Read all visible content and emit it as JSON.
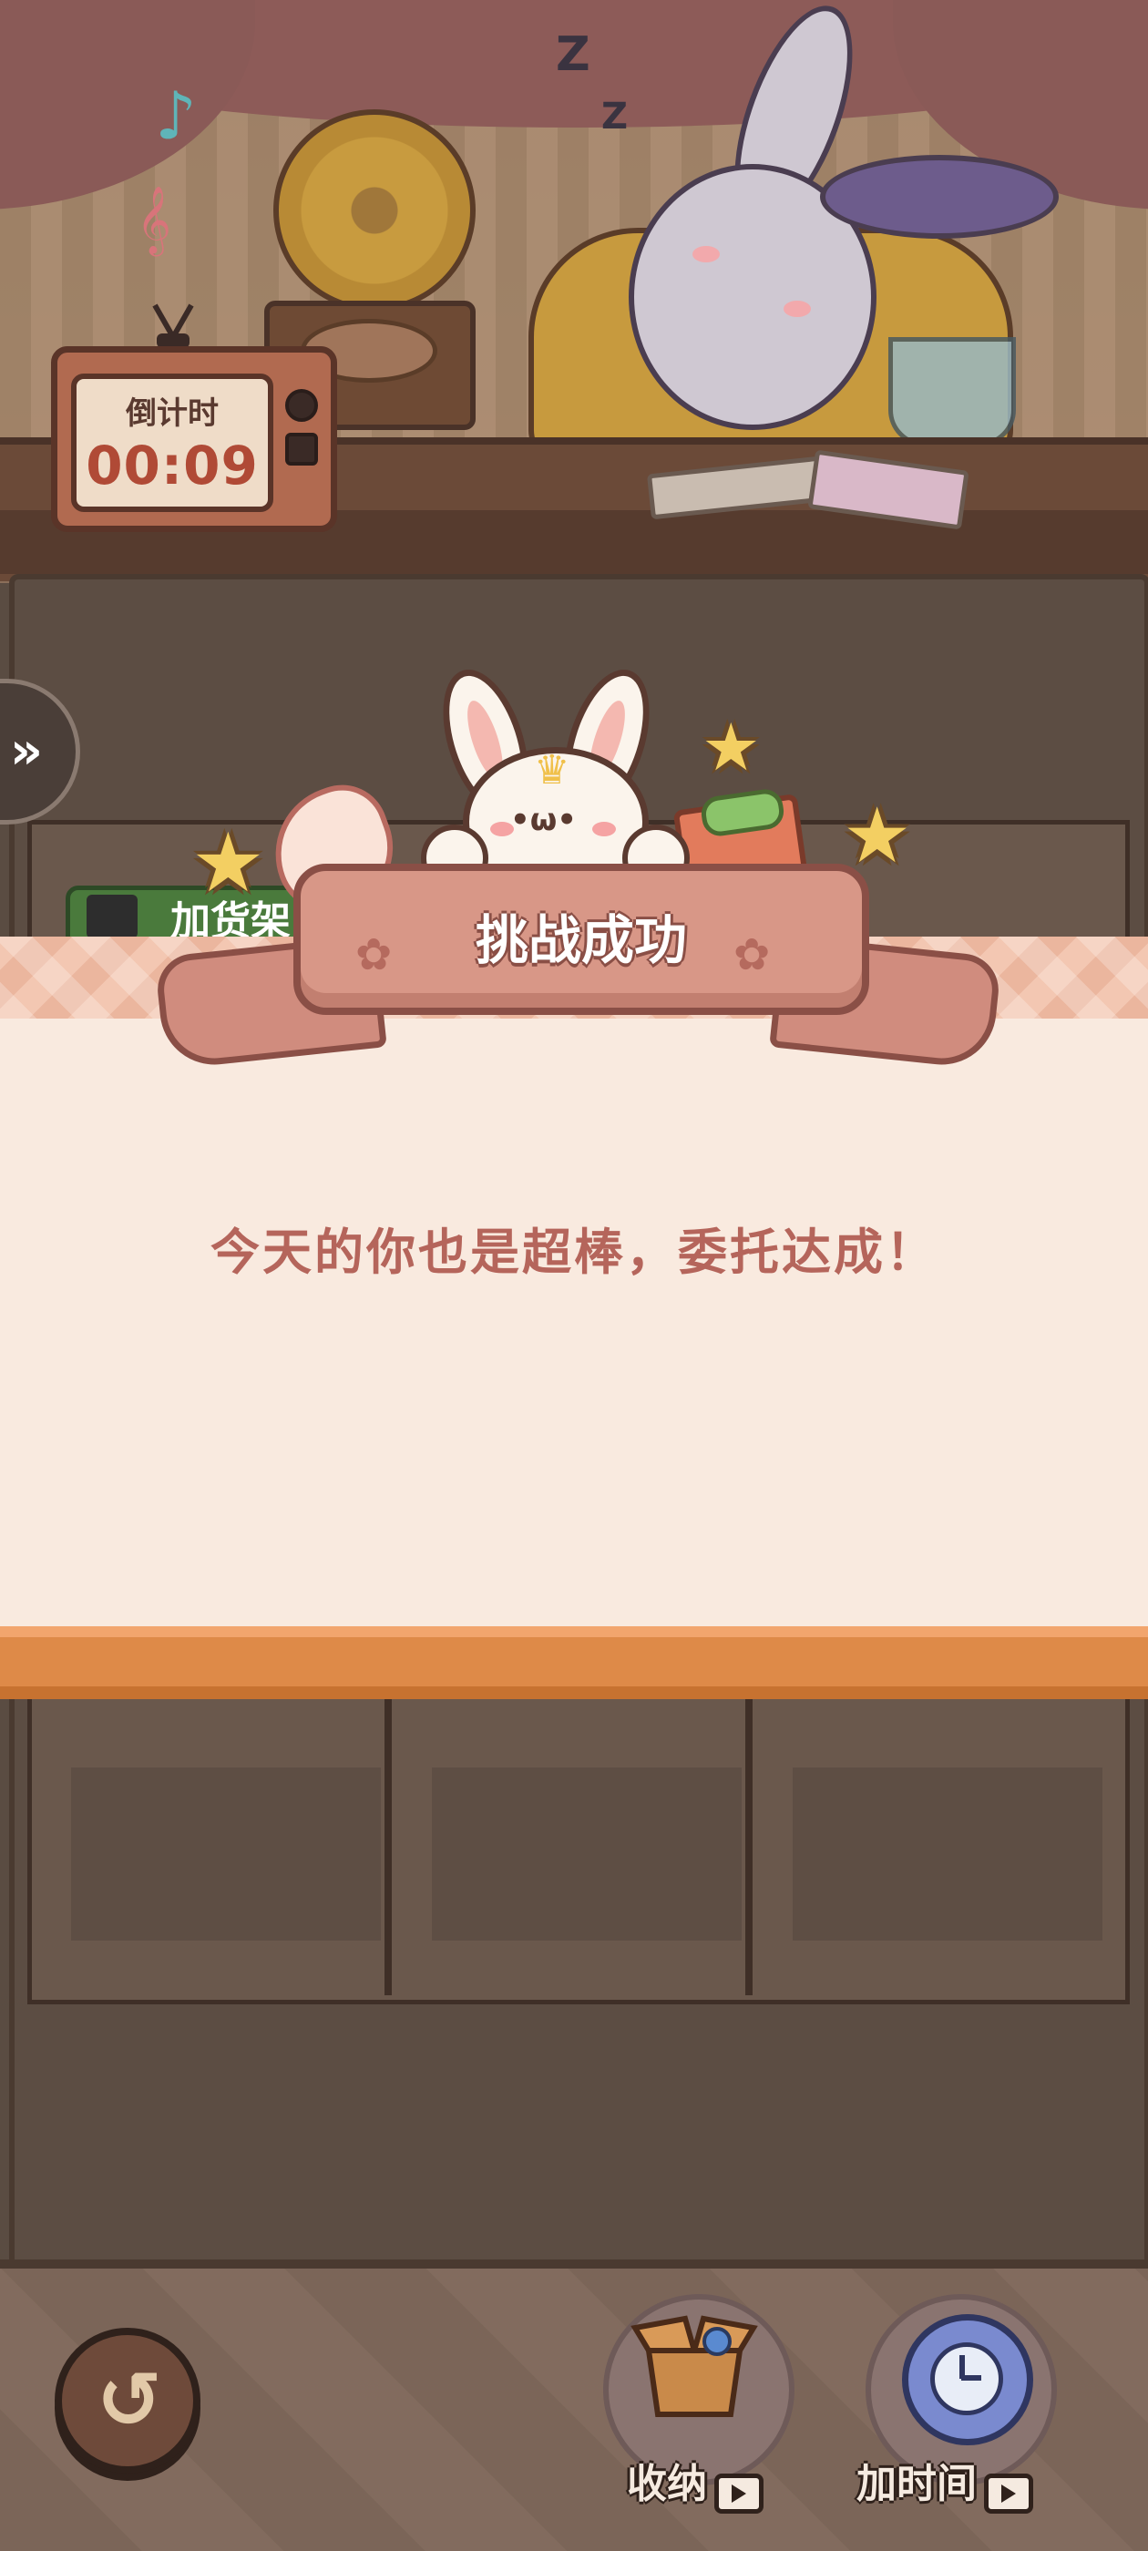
{
  "scene": {
    "countdown_label": "倒计时",
    "countdown_time": "00:09",
    "notes": [
      "♪",
      "𝄞"
    ],
    "sleep_marks": [
      "Z",
      "Z"
    ]
  },
  "side_panel": {
    "expand_glyph": "»"
  },
  "shelf": {
    "add_goods_label": "加货架"
  },
  "dialog": {
    "title": "挑战成功",
    "message": "今天的你也是超棒，委托达成！"
  },
  "toolbar": {
    "back_glyph": "↺",
    "storage_label": "收纳",
    "add_time_label": "加时间"
  },
  "colors": {
    "dialog_bg": "#f9eadf",
    "message_text": "#b5655b",
    "ribbon": "#d89787",
    "ribbon_border": "#8a4f46",
    "orange_band": "#de8a48"
  }
}
